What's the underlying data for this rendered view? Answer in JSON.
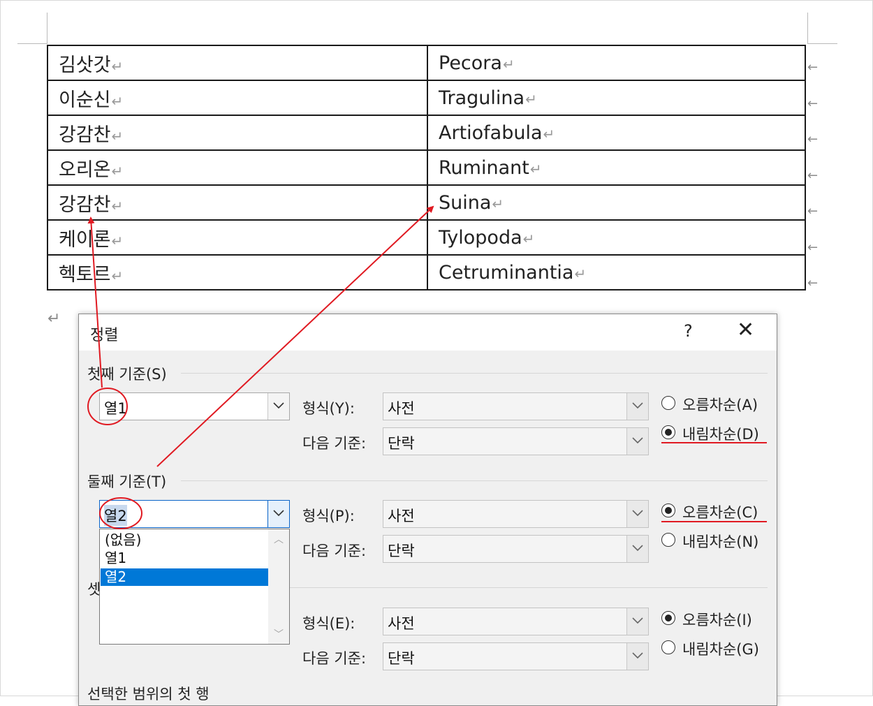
{
  "table": {
    "rows": [
      {
        "col1": "김삿갓",
        "col2": "Pecora"
      },
      {
        "col1": "이순신",
        "col2": "Tragulina"
      },
      {
        "col1": "강감찬",
        "col2": "Artiofabula"
      },
      {
        "col1": "오리온",
        "col2": "Ruminant"
      },
      {
        "col1": "강감찬",
        "col2": "Suina"
      },
      {
        "col1": "케이론",
        "col2": "Tylopoda"
      },
      {
        "col1": "헥토르",
        "col2": "Cetruminantia"
      }
    ],
    "para_mark": "↵",
    "row_end_mark": "←"
  },
  "dialog": {
    "title": "정렬",
    "help_label": "?",
    "close_label": "✕",
    "first_key": {
      "label": "첫째 기준(S)",
      "column": "열1",
      "type_label": "형식(Y):",
      "type_value": "사전",
      "using_label": "다음 기준:",
      "using_value": "단락",
      "asc_label": "오름차순(A)",
      "desc_label": "내림차순(D)",
      "order": "desc"
    },
    "second_key": {
      "label": "둘째 기준(T)",
      "column": "열2",
      "type_label": "형식(P):",
      "type_value": "사전",
      "using_label": "다음 기준:",
      "using_value": "단락",
      "asc_label": "오름차순(C)",
      "desc_label": "내림차순(N)",
      "order": "asc",
      "dropdown_options": [
        "(없음)",
        "열1",
        "열2"
      ],
      "dropdown_selected": "열2"
    },
    "third_key": {
      "label_partial": "셋",
      "type_label": "형식(E):",
      "type_value": "사전",
      "using_label": "다음 기준:",
      "using_value": "단락",
      "asc_label": "오름차순(I)",
      "desc_label": "내림차순(G)",
      "order": "asc"
    },
    "bottom_partial": "선택한 범위의 첫 행"
  },
  "annotation_color": "#e01a22"
}
